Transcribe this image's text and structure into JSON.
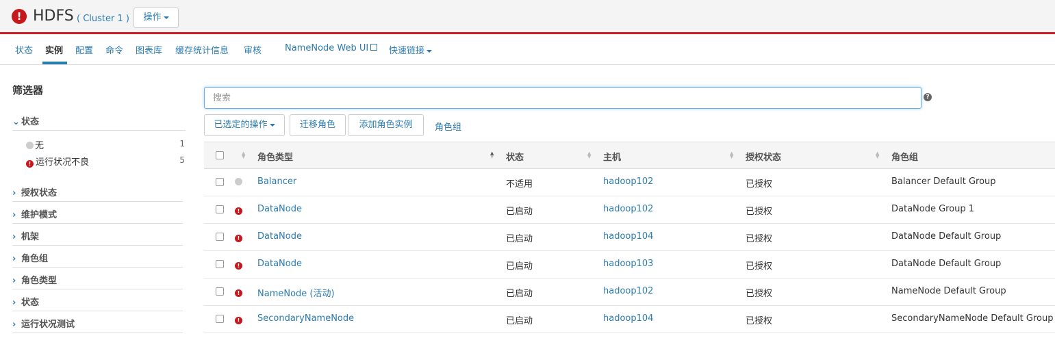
{
  "header": {
    "icon": "exclamation-circle-icon",
    "title": "HDFS",
    "cluster": "( Cluster 1 )",
    "actions_label": "操作",
    "accent_color": "#cc1e24"
  },
  "nav": {
    "tabs": [
      {
        "label": "状态",
        "active": false
      },
      {
        "label": "实例",
        "active": true
      },
      {
        "label": "配置",
        "active": false
      },
      {
        "label": "命令",
        "active": false
      },
      {
        "label": "图表库",
        "active": false
      },
      {
        "label": "缓存统计信息",
        "active": false
      },
      {
        "label": "审核",
        "active": false
      }
    ],
    "namenode_link": "NameNode Web UI",
    "quick_links": "快速链接"
  },
  "sidebar": {
    "title": "筛选器",
    "status_section": {
      "label": "状态",
      "expanded": true,
      "items": [
        {
          "label": "无",
          "count": "1",
          "icon": "grey-dot-icon"
        },
        {
          "label": "运行状况不良",
          "count": "5",
          "icon": "red-exclamation-icon"
        }
      ]
    },
    "collapsed_sections": [
      "授权状态",
      "维护模式",
      "机架",
      "角色组",
      "角色类型",
      "状态",
      "运行状况测试"
    ]
  },
  "main": {
    "search_placeholder": "搜索",
    "buttons": {
      "selected_actions": "已选定的操作",
      "migrate_role": "迁移角色",
      "add_role_instance": "添加角色实例",
      "role_groups": "角色组"
    },
    "table": {
      "headers": {
        "role_type": "角色类型",
        "status": "状态",
        "host": "主机",
        "commission_state": "授权状态",
        "role_group": "角色组"
      },
      "rows": [
        {
          "health": "none",
          "role_type": "Balancer",
          "status": "不适用",
          "host": "hadoop102",
          "commission": "已授权",
          "role_group": "Balancer Default Group"
        },
        {
          "health": "bad",
          "role_type": "DataNode",
          "status": "已启动",
          "host": "hadoop102",
          "commission": "已授权",
          "role_group": "DataNode Group 1"
        },
        {
          "health": "bad",
          "role_type": "DataNode",
          "status": "已启动",
          "host": "hadoop104",
          "commission": "已授权",
          "role_group": "DataNode Default Group"
        },
        {
          "health": "bad",
          "role_type": "DataNode",
          "status": "已启动",
          "host": "hadoop103",
          "commission": "已授权",
          "role_group": "DataNode Default Group"
        },
        {
          "health": "bad",
          "role_type": "NameNode (活动)",
          "status": "已启动",
          "host": "hadoop102",
          "commission": "已授权",
          "role_group": "NameNode Default Group"
        },
        {
          "health": "bad",
          "role_type": "SecondaryNameNode",
          "status": "已启动",
          "host": "hadoop104",
          "commission": "已授权",
          "role_group": "SecondaryNameNode Default Group"
        }
      ]
    }
  }
}
